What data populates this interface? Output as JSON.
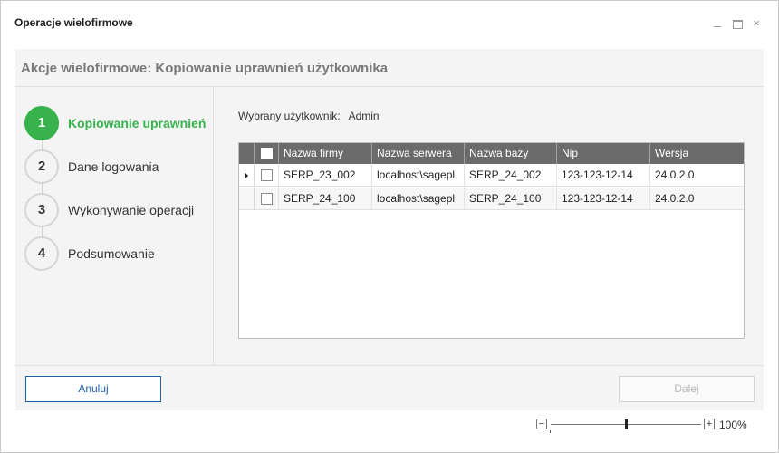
{
  "window": {
    "title": "Operacje wielofirmowe",
    "minimize_icon": "minimize-icon",
    "maximize_icon": "maximize-icon",
    "close_glyph": "×"
  },
  "header": {
    "title": "Akcje wielofirmowe: Kopiowanie uprawnień użytkownika"
  },
  "steps": [
    {
      "number": "1",
      "label": "Kopiowanie uprawnień",
      "active": true
    },
    {
      "number": "2",
      "label": "Dane logowania",
      "active": false
    },
    {
      "number": "3",
      "label": "Wykonywanie operacji",
      "active": false
    },
    {
      "number": "4",
      "label": "Podsumowanie",
      "active": false
    }
  ],
  "user": {
    "label": "Wybrany użytkownik:",
    "value": "Admin"
  },
  "grid": {
    "columns": [
      "Nazwa firmy",
      "Nazwa serwera",
      "Nazwa bazy",
      "Nip",
      "Wersja"
    ],
    "rows": [
      {
        "firma": "SERP_23_002",
        "serwer": "localhost\\sagepl",
        "baza": "SERP_24_002",
        "nip": "123-123-12-14",
        "wersja": "24.0.2.0",
        "checked": false,
        "current": true
      },
      {
        "firma": "SERP_24_100",
        "serwer": "localhost\\sagepl",
        "baza": "SERP_24_100",
        "nip": "123-123-12-14",
        "wersja": "24.0.2.0",
        "checked": false,
        "current": false
      }
    ]
  },
  "footer": {
    "cancel_label": "Anuluj",
    "next_label": "Dalej"
  },
  "zoom": {
    "minus": "−",
    "plus": "+",
    "value": "100%"
  },
  "colors": {
    "accent_green": "#37b24d",
    "header_gray": "#6b6b6b",
    "cancel_blue": "#1f5fa8"
  }
}
